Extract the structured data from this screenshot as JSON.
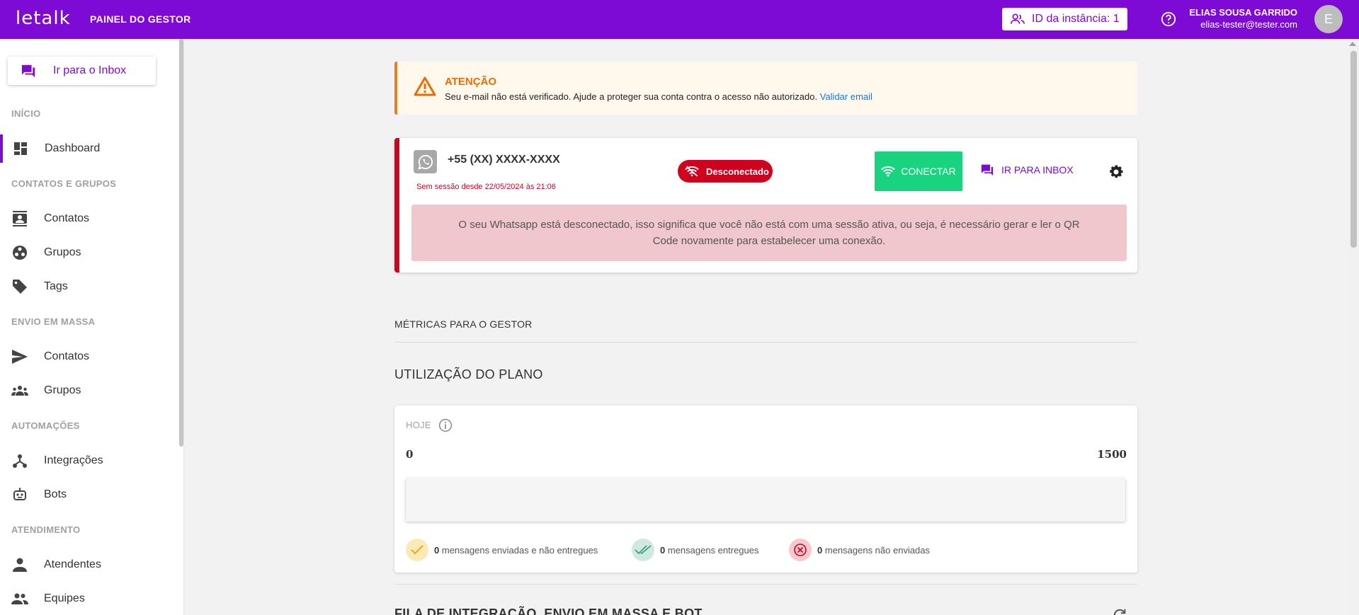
{
  "header": {
    "logo": "letalk",
    "app_title": "PAINEL DO GESTOR",
    "instance_label": "ID da instância: 1",
    "user_name": "ELIAS SOUSA GARRIDO",
    "user_email": "elias-tester@tester.com",
    "avatar_letter": "E"
  },
  "sidebar": {
    "inbox_button": "Ir para o Inbox",
    "sections": [
      {
        "title": "INÍCIO",
        "items": [
          {
            "label": "Dashboard",
            "icon": "dashboard-icon",
            "active": true
          }
        ]
      },
      {
        "title": "CONTATOS E GRUPOS",
        "items": [
          {
            "label": "Contatos",
            "icon": "contacts-icon"
          },
          {
            "label": "Grupos",
            "icon": "groups-icon"
          },
          {
            "label": "Tags",
            "icon": "tag-icon"
          }
        ]
      },
      {
        "title": "ENVIO EM MASSA",
        "items": [
          {
            "label": "Contatos",
            "icon": "send-icon"
          },
          {
            "label": "Grupos",
            "icon": "people-icon"
          }
        ]
      },
      {
        "title": "AUTOMAÇÕES",
        "items": [
          {
            "label": "Integrações",
            "icon": "integration-icon"
          },
          {
            "label": "Bots",
            "icon": "bot-icon"
          }
        ]
      },
      {
        "title": "ATENDIMENTO",
        "items": [
          {
            "label": "Atendentes",
            "icon": "person-icon"
          },
          {
            "label": "Equipes",
            "icon": "team-icon"
          }
        ]
      }
    ]
  },
  "alert": {
    "title": "ATENÇÃO",
    "text": "Seu e-mail não está verificado. Ajude a proteger sua conta contra o acesso não autorizado.",
    "link": "Validar email",
    "color": "#ed6c02"
  },
  "whatsapp": {
    "phone": "+55 (XX) XXXX-XXXX",
    "since": "Sem sessão desde 22/05/2024 às 21:06",
    "status": "Desconectado",
    "connect_label": "CONECTAR",
    "inbox_label": "IR PARA INBOX",
    "warning": "O seu Whatsapp está desconectado, isso significa que você não está com uma sessão ativa, ou seja, é necessário gerar e ler o QR Code novamente para estabelecer uma conexão.",
    "status_color": "#d1001f",
    "connect_color": "#19d47f"
  },
  "metrics": {
    "section_title": "MÉTRICAS PARA O GESTOR",
    "plan_title": "UTILIZAÇÃO DO PLANO",
    "today_label": "HOJE",
    "range_min": "0",
    "range_max": "1500",
    "usage_fraction": 0,
    "legend": [
      {
        "count": "0",
        "text": "mensagens enviadas e não entregues",
        "icon": "check-icon"
      },
      {
        "count": "0",
        "text": "mensagens entregues",
        "icon": "double-check-icon"
      },
      {
        "count": "0",
        "text": "mensagens não enviadas",
        "icon": "x-circle-icon"
      }
    ],
    "queue_title": "FILA DE INTEGRAÇÃO, ENVIO EM MASSA E BOT"
  },
  "colors": {
    "brand": "#7e0ad6"
  }
}
